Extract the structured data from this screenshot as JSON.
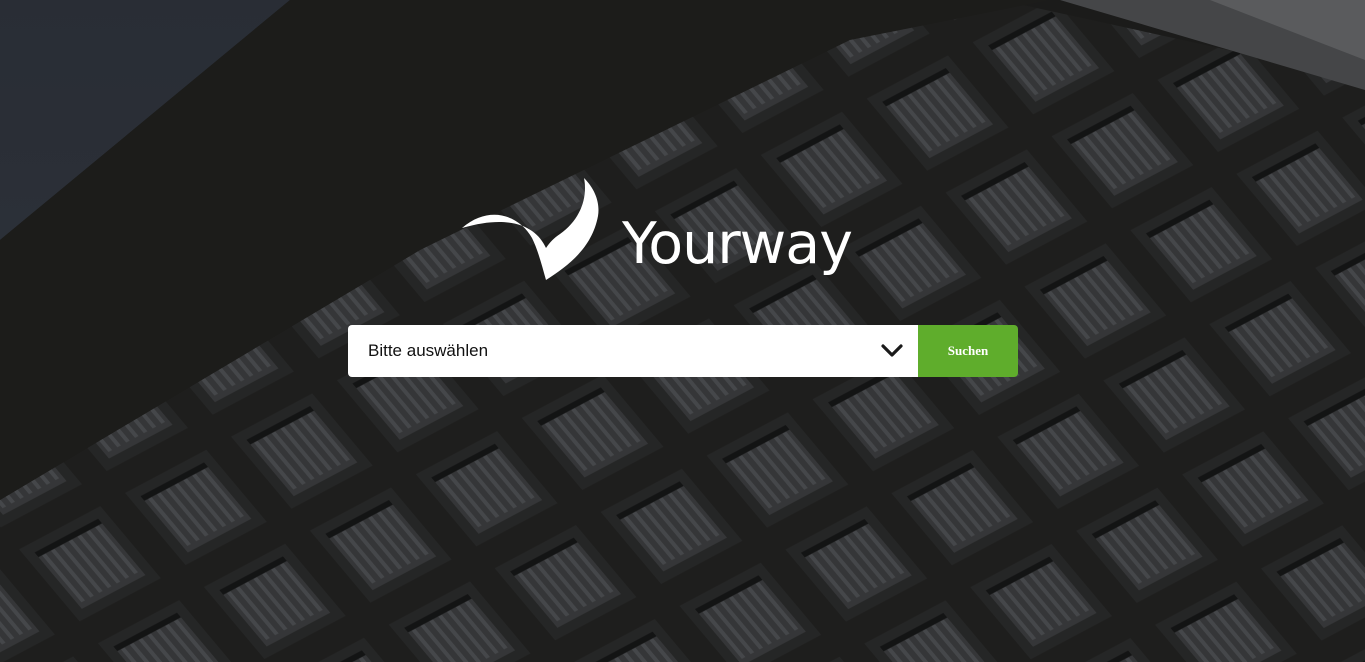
{
  "brand": {
    "name": "Yourway",
    "logo_icon": "swoosh-check-icon"
  },
  "search": {
    "select_value": "Bitte auswählen",
    "dropdown_icon": "chevron-down-icon",
    "button_label": "Suchen"
  },
  "colors": {
    "accent": "#5fad2c",
    "background": "#262624",
    "text_light": "#ffffff"
  }
}
